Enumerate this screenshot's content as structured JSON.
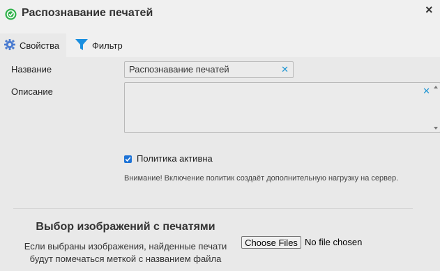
{
  "window": {
    "title": "Распознавание печатей",
    "close_label": "×"
  },
  "tabs": [
    {
      "label": "Свойства",
      "icon": "gear-icon",
      "active": true
    },
    {
      "label": "Фильтр",
      "icon": "filter-icon",
      "active": false
    }
  ],
  "form": {
    "name_label": "Название",
    "name_value": "Распознавание печатей",
    "description_label": "Описание",
    "description_value": "",
    "active_label": "Политика активна",
    "active_checked": true,
    "warning": "Внимание! Включение политик создаёт дополнительную нагрузку на сервер."
  },
  "image_section": {
    "title": "Выбор изображений с печатями",
    "description_line1": "Если выбраны изображения, найденные печати",
    "description_line2": "будут помечаться меткой с названием файла",
    "choose_files_label": "Choose Files",
    "file_status": "No file chosen"
  },
  "colors": {
    "accent": "#2196d3",
    "checkbox": "#1e73d6",
    "app_icon": "#2fb24a"
  }
}
